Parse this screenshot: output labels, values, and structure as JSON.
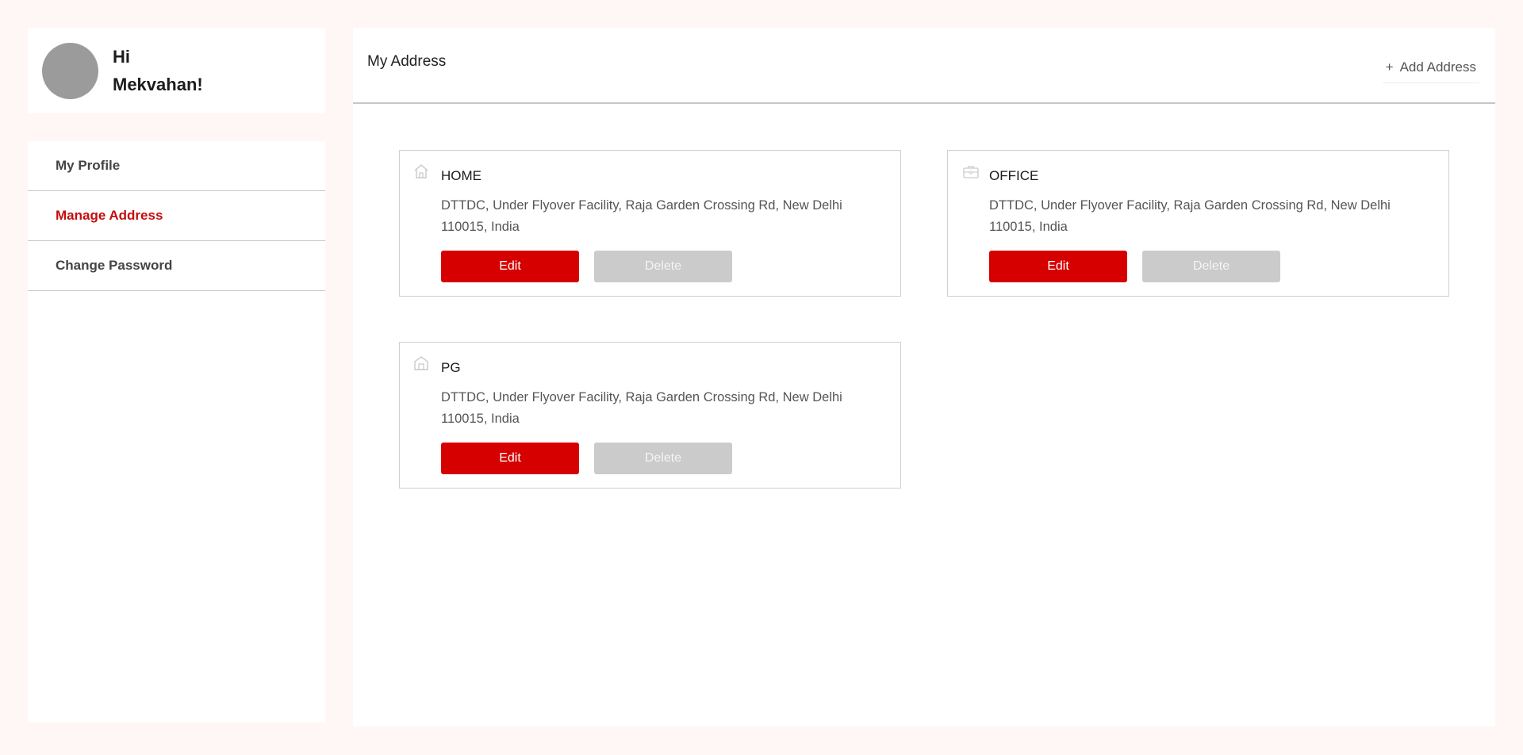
{
  "user": {
    "greeting": "Hi",
    "name": "Mekvahan!"
  },
  "sidebar": {
    "items": [
      {
        "label": "My Profile",
        "active": false
      },
      {
        "label": "Manage Address",
        "active": true
      },
      {
        "label": "Change Password",
        "active": false
      }
    ]
  },
  "main": {
    "title": "My Address",
    "add_button": {
      "icon": "+",
      "label": "Add Address"
    }
  },
  "addresses": [
    {
      "type": "HOME",
      "icon": "home-icon",
      "address": "DTTDC, Under Flyover Facility, Raja Garden Crossing Rd, New Delhi 110015, India",
      "edit_label": "Edit",
      "delete_label": "Delete"
    },
    {
      "type": "OFFICE",
      "icon": "briefcase-icon",
      "address": "DTTDC, Under Flyover Facility, Raja Garden Crossing Rd, New Delhi 110015, India",
      "edit_label": "Edit",
      "delete_label": "Delete"
    },
    {
      "type": "PG",
      "icon": "building-icon",
      "address": "DTTDC, Under Flyover Facility, Raja Garden Crossing Rd, New Delhi 110015, India",
      "edit_label": "Edit",
      "delete_label": "Delete"
    }
  ],
  "colors": {
    "accent": "#d60000",
    "active_nav": "#c40d0d",
    "disabled_button": "#cbcbcb",
    "page_background": "#fff7f6"
  }
}
